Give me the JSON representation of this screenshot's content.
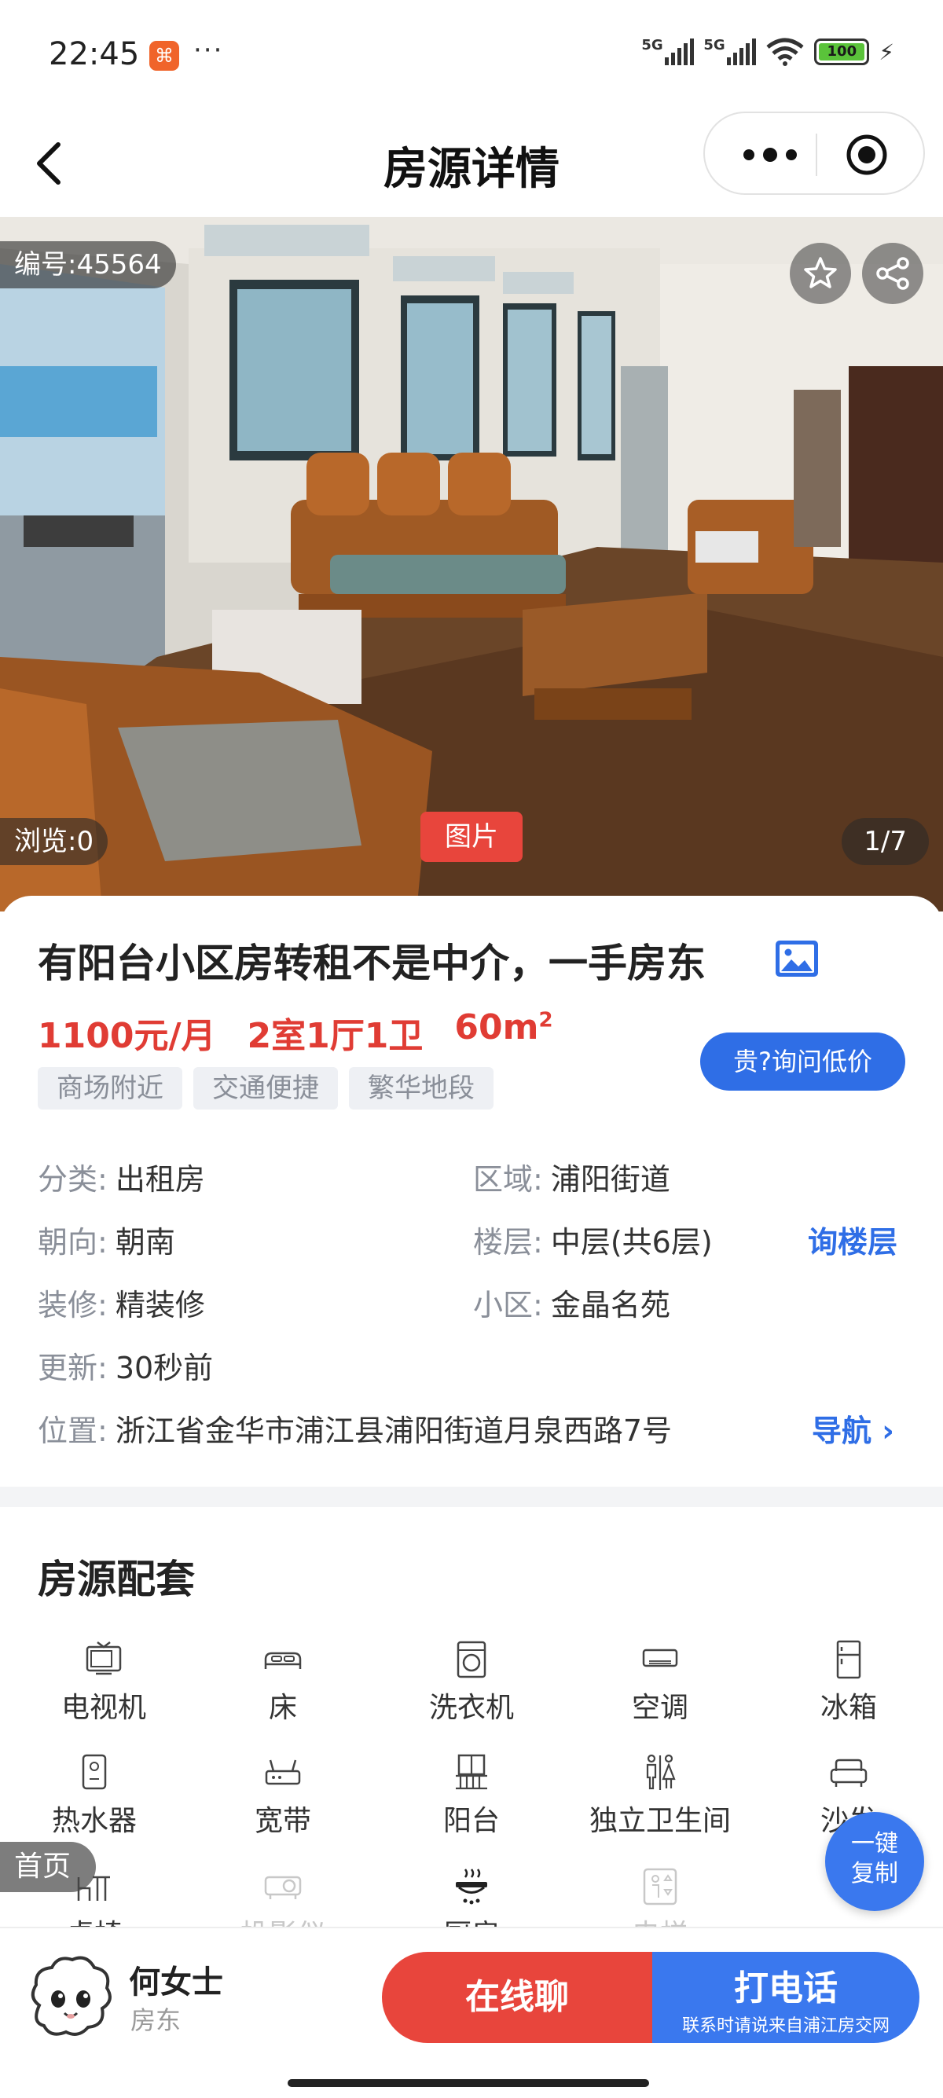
{
  "status_bar": {
    "time": "22:45",
    "more": "···",
    "signal1": "5G",
    "signal2": "5G",
    "battery": "100"
  },
  "nav": {
    "title": "房源详情",
    "back_icon": "chevron-left-icon",
    "more_icon": "more-dots-icon",
    "close_icon": "target-circle-icon"
  },
  "hero": {
    "code": "编号:45564",
    "views": "浏览:0",
    "media_tag": "图片",
    "counter": "1/7"
  },
  "listing": {
    "title": "有阳台小区房转租不是中介，一手房东",
    "price": "1100元/月",
    "layout": "2室1厅1卫",
    "area": "60m",
    "area_sup": "2",
    "ask_button": "贵?询问低价",
    "tags": [
      "商场附近",
      "交通便捷",
      "繁华地段"
    ]
  },
  "details": {
    "category_label": "分类:",
    "category": "出租房",
    "district_label": "区域:",
    "district": "浦阳街道",
    "orientation_label": "朝向:",
    "orientation": "朝南",
    "floor_label": "楼层:",
    "floor": "中层(共6层)",
    "floor_link": "询楼层",
    "decoration_label": "装修:",
    "decoration": "精装修",
    "community_label": "小区:",
    "community": "金晶名苑",
    "updated_label": "更新:",
    "updated": "30秒前",
    "location_label": "位置:",
    "location": "浙江省金华市浦江县浦阳街道月泉西路7号",
    "nav_link": "导航"
  },
  "amenities": {
    "title": "房源配套",
    "items": [
      {
        "label": "电视机",
        "icon": "tv-icon"
      },
      {
        "label": "床",
        "icon": "bed-icon"
      },
      {
        "label": "洗衣机",
        "icon": "washer-icon"
      },
      {
        "label": "空调",
        "icon": "air-conditioner-icon"
      },
      {
        "label": "冰箱",
        "icon": "fridge-icon"
      },
      {
        "label": "热水器",
        "icon": "water-heater-icon"
      },
      {
        "label": "宽带",
        "icon": "router-icon"
      },
      {
        "label": "阳台",
        "icon": "balcony-icon"
      },
      {
        "label": "独立卫生间",
        "icon": "restroom-icon"
      },
      {
        "label": "沙发",
        "icon": "sofa-icon"
      },
      {
        "label": "桌椅",
        "icon": "desk-chair-icon"
      },
      {
        "label": "投影仪",
        "icon": "projector-icon"
      },
      {
        "label": "厨房",
        "icon": "kitchen-icon"
      },
      {
        "label": "电梯",
        "icon": "elevator-icon"
      }
    ]
  },
  "floating": {
    "home": "首页",
    "copy_line1": "一键",
    "copy_line2": "复制"
  },
  "bottom": {
    "landlord_name": "何女士",
    "landlord_role": "房东",
    "chat_button": "在线聊",
    "call_button": "打电话",
    "call_sub": "联系时请说来自浦江房交网"
  },
  "colors": {
    "price_red": "#e03c34",
    "accent_blue": "#2f6ee6",
    "chat_red": "#e8453c"
  }
}
